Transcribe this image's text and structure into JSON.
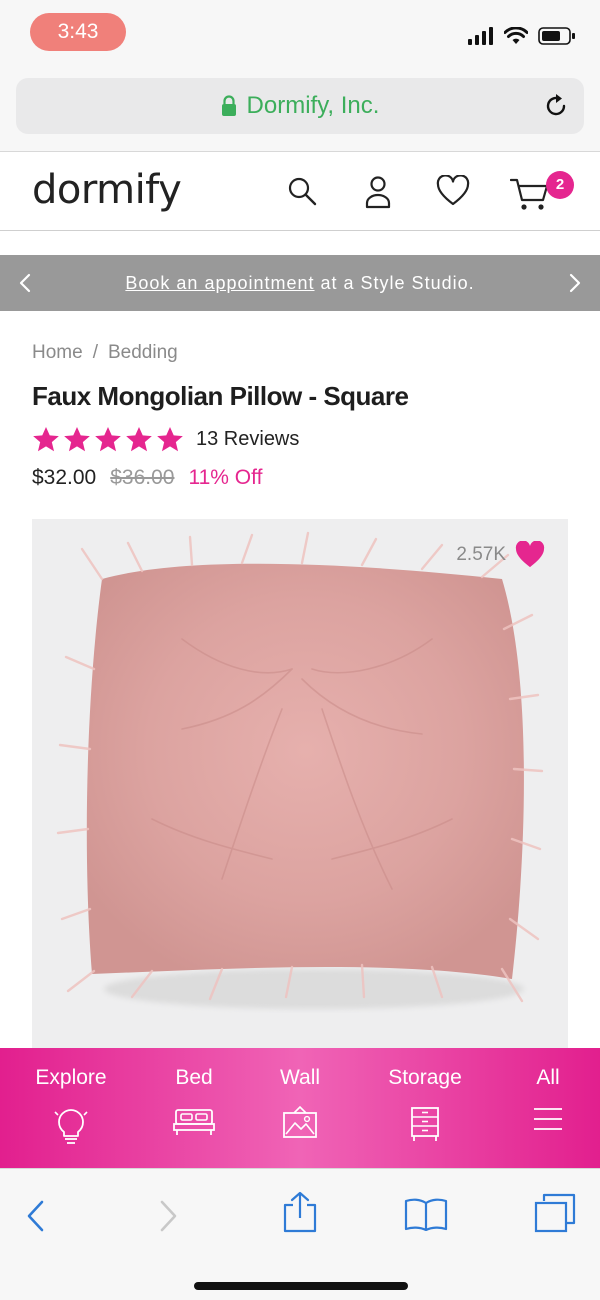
{
  "status_bar": {
    "time": "3:43"
  },
  "browser": {
    "url_title": "Dormify, Inc.",
    "icons": [
      "lock-icon",
      "reload-icon"
    ]
  },
  "header": {
    "logo": "dormify",
    "cart_count": "2",
    "icons": [
      "search-icon",
      "account-icon",
      "heart-icon",
      "cart-icon"
    ]
  },
  "promo": {
    "link_text": "Book an appointment",
    "rest_text": " at a Style Studio."
  },
  "product": {
    "breadcrumb": [
      "Home",
      "/",
      "Bedding"
    ],
    "title": "Faux Mongolian Pillow - Square",
    "rating_stars": 5,
    "reviews": "13 Reviews",
    "price": "$32.00",
    "old_price": "$36.00",
    "discount": "11% Off",
    "likes": "2.57K"
  },
  "categories": [
    {
      "label": "Explore",
      "icon": "lightbulb-icon"
    },
    {
      "label": "Bed",
      "icon": "bed-icon"
    },
    {
      "label": "Wall",
      "icon": "picture-icon"
    },
    {
      "label": "Storage",
      "icon": "dresser-icon"
    },
    {
      "label": "All",
      "icon": "menu-icon"
    }
  ],
  "colors": {
    "accent": "#e5268f",
    "url_green": "#3cae5b",
    "ios_blue": "#2f7bd6"
  }
}
